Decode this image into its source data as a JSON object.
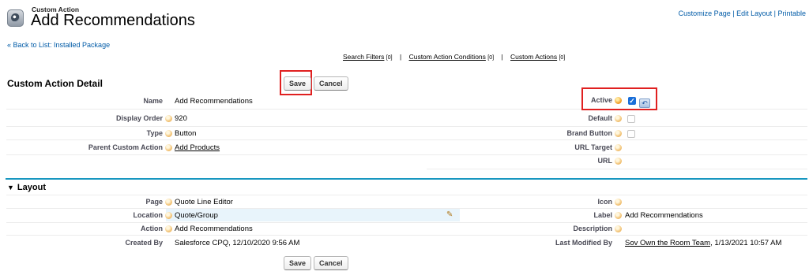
{
  "header": {
    "object_type": "Custom Action",
    "title": "Add Recommendations",
    "links": [
      "Customize Page",
      "Edit Layout",
      "Printable"
    ]
  },
  "back_link": "« Back to List: Installed Package",
  "related_links": [
    {
      "label": "Search Filters",
      "count": "[0]"
    },
    {
      "label": "Custom Action Conditions",
      "count": "[0]"
    },
    {
      "label": "Custom Actions",
      "count": "[0]"
    }
  ],
  "buttons": {
    "save": "Save",
    "cancel": "Cancel"
  },
  "detail": {
    "title": "Custom Action Detail",
    "left": [
      {
        "label": "Name",
        "value": "Add Recommendations"
      },
      {
        "label": "Display Order",
        "value": "920"
      },
      {
        "label": "Type",
        "value": "Button"
      },
      {
        "label": "Parent Custom Action",
        "value": "Add Products"
      }
    ],
    "right": [
      {
        "label": "Active",
        "checked": true
      },
      {
        "label": "Default",
        "checked": false
      },
      {
        "label": "Brand Button",
        "checked": false
      },
      {
        "label": "URL Target",
        "value": ""
      },
      {
        "label": "URL",
        "value": ""
      }
    ]
  },
  "layout": {
    "title": "Layout",
    "left": [
      {
        "label": "Page",
        "value": "Quote Line Editor"
      },
      {
        "label": "Location",
        "value": "Quote/Group"
      },
      {
        "label": "Action",
        "value": "Add Recommendations"
      },
      {
        "label": "Created By",
        "value": "Salesforce CPQ, 12/10/2020 9:56 AM"
      }
    ],
    "right": [
      {
        "label": "Icon",
        "value": ""
      },
      {
        "label": "Label",
        "value": "Add Recommendations"
      },
      {
        "label": "Description",
        "value": ""
      },
      {
        "label": "Last Modified By",
        "value_link": "Sov Own the Room Team",
        "value_rest": ", 1/13/2021 10:57 AM"
      }
    ]
  },
  "colors": {
    "link": "#015ba7",
    "highlight": "#e02020",
    "section_rule": "#1797c0"
  }
}
